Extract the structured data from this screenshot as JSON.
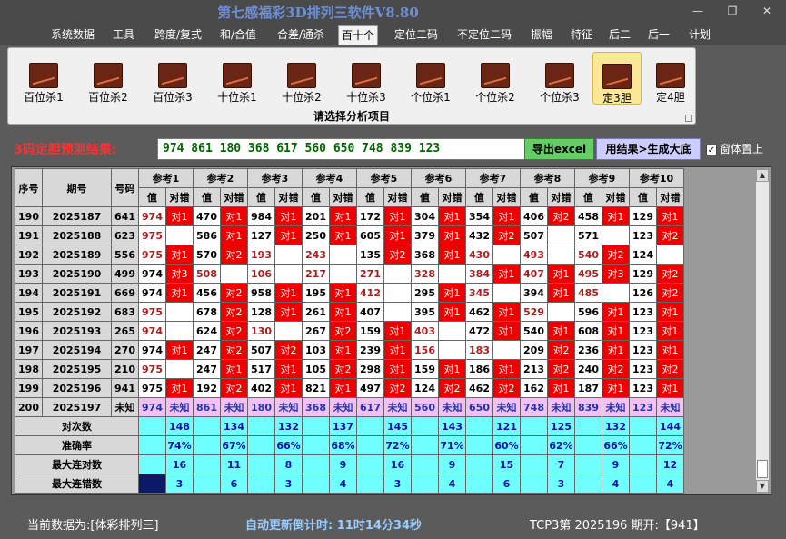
{
  "window": {
    "title": "第七感福彩3D排列三软件V8.80",
    "minimize": "—",
    "restore": "❐",
    "close": "✕"
  },
  "menu": [
    "系统数据",
    "工具",
    "跨度/复式",
    "和/合值",
    "合差/通杀",
    "百十个",
    "定位二码",
    "不定位二码",
    "振幅",
    "特征",
    "后二",
    "后一",
    "计划"
  ],
  "menu_active": 5,
  "ribbon": {
    "buttons": [
      "百位杀1",
      "百位杀2",
      "百位杀3",
      "十位杀1",
      "十位杀2",
      "十位杀3",
      "个位杀1",
      "个位杀2",
      "个位杀3",
      "定3胆",
      "定4胆"
    ],
    "selected": 9,
    "caption": "请选择分析项目"
  },
  "predict": {
    "label": "3码定胆预测结果:",
    "value": "974 861 180 368 617 560 650 748 839 123",
    "export_label": "导出excel",
    "generate_label": "用结果>生成大底",
    "topmost_label": "窗体置上",
    "topmost_checked": "✓"
  },
  "table": {
    "headers": {
      "seq": "序号",
      "issue": "期号",
      "code": "号码",
      "value": "值",
      "result": "对错"
    },
    "refs": [
      "参考1",
      "参考2",
      "参考3",
      "参考4",
      "参考5",
      "参考6",
      "参考7",
      "参考8",
      "参考9",
      "参考10"
    ],
    "rows": [
      {
        "seq": "190",
        "issue": "2025187",
        "code": "641",
        "cells": [
          [
            "974",
            "对1"
          ],
          [
            "470",
            "对1"
          ],
          [
            "984",
            "对1"
          ],
          [
            "201",
            "对1"
          ],
          [
            "172",
            "对1"
          ],
          [
            "304",
            "对1"
          ],
          [
            "354",
            "对1"
          ],
          [
            "406",
            "对2"
          ],
          [
            "458",
            "对1"
          ],
          [
            "129",
            "对1"
          ]
        ]
      },
      {
        "seq": "191",
        "issue": "2025188",
        "code": "623",
        "cells": [
          [
            "975",
            ""
          ],
          [
            "586",
            "对1"
          ],
          [
            "127",
            "对1"
          ],
          [
            "250",
            "对1"
          ],
          [
            "605",
            "对1"
          ],
          [
            "379",
            "对1"
          ],
          [
            "432",
            "对2"
          ],
          [
            "507",
            ""
          ],
          [
            "571",
            ""
          ],
          [
            "123",
            "对2"
          ]
        ]
      },
      {
        "seq": "192",
        "issue": "2025189",
        "code": "556",
        "cells": [
          [
            "975",
            "对1"
          ],
          [
            "570",
            "对2"
          ],
          [
            "193",
            ""
          ],
          [
            "243",
            ""
          ],
          [
            "135",
            "对2"
          ],
          [
            "368",
            "对1"
          ],
          [
            "430",
            ""
          ],
          [
            "493",
            ""
          ],
          [
            "540",
            "对2"
          ],
          [
            "124",
            ""
          ]
        ]
      },
      {
        "seq": "193",
        "issue": "2025190",
        "code": "499",
        "cells": [
          [
            "974",
            "对3"
          ],
          [
            "508",
            ""
          ],
          [
            "106",
            ""
          ],
          [
            "217",
            ""
          ],
          [
            "271",
            ""
          ],
          [
            "328",
            ""
          ],
          [
            "384",
            "对1"
          ],
          [
            "407",
            "对1"
          ],
          [
            "495",
            "对3"
          ],
          [
            "129",
            "对2"
          ]
        ]
      },
      {
        "seq": "194",
        "issue": "2025191",
        "code": "669",
        "cells": [
          [
            "974",
            "对1"
          ],
          [
            "456",
            "对2"
          ],
          [
            "958",
            "对1"
          ],
          [
            "195",
            "对1"
          ],
          [
            "412",
            ""
          ],
          [
            "295",
            "对1"
          ],
          [
            "345",
            ""
          ],
          [
            "394",
            "对1"
          ],
          [
            "485",
            ""
          ],
          [
            "126",
            "对2"
          ]
        ]
      },
      {
        "seq": "195",
        "issue": "2025192",
        "code": "683",
        "cells": [
          [
            "975",
            ""
          ],
          [
            "678",
            "对2"
          ],
          [
            "128",
            "对1"
          ],
          [
            "261",
            "对1"
          ],
          [
            "407",
            ""
          ],
          [
            "395",
            "对1"
          ],
          [
            "462",
            "对1"
          ],
          [
            "529",
            ""
          ],
          [
            "596",
            "对1"
          ],
          [
            "123",
            "对1"
          ]
        ]
      },
      {
        "seq": "196",
        "issue": "2025193",
        "code": "265",
        "cells": [
          [
            "974",
            ""
          ],
          [
            "624",
            "对2"
          ],
          [
            "130",
            ""
          ],
          [
            "267",
            "对2"
          ],
          [
            "159",
            "对1"
          ],
          [
            "403",
            ""
          ],
          [
            "472",
            "对1"
          ],
          [
            "540",
            "对1"
          ],
          [
            "608",
            "对1"
          ],
          [
            "123",
            "对1"
          ]
        ]
      },
      {
        "seq": "197",
        "issue": "2025194",
        "code": "270",
        "cells": [
          [
            "974",
            "对1"
          ],
          [
            "247",
            "对2"
          ],
          [
            "507",
            "对2"
          ],
          [
            "103",
            "对1"
          ],
          [
            "239",
            "对1"
          ],
          [
            "156",
            ""
          ],
          [
            "183",
            ""
          ],
          [
            "209",
            "对2"
          ],
          [
            "236",
            "对1"
          ],
          [
            "123",
            "对1"
          ]
        ]
      },
      {
        "seq": "198",
        "issue": "2025195",
        "code": "210",
        "cells": [
          [
            "975",
            ""
          ],
          [
            "247",
            "对1"
          ],
          [
            "517",
            "对1"
          ],
          [
            "105",
            "对2"
          ],
          [
            "298",
            "对1"
          ],
          [
            "159",
            "对1"
          ],
          [
            "186",
            "对1"
          ],
          [
            "213",
            "对2"
          ],
          [
            "240",
            "对2"
          ],
          [
            "123",
            "对2"
          ]
        ]
      },
      {
        "seq": "199",
        "issue": "2025196",
        "code": "941",
        "cells": [
          [
            "975",
            "对1"
          ],
          [
            "192",
            "对2"
          ],
          [
            "402",
            "对1"
          ],
          [
            "821",
            "对1"
          ],
          [
            "497",
            "对2"
          ],
          [
            "124",
            "对2"
          ],
          [
            "462",
            "对2"
          ],
          [
            "162",
            "对1"
          ],
          [
            "187",
            "对1"
          ],
          [
            "123",
            "对1"
          ]
        ]
      }
    ],
    "red_values": [
      [
        0,
        "0"
      ],
      [
        1,
        "0"
      ],
      [
        2,
        "0,2,3,6,7,8"
      ],
      [
        3,
        "1,2,3,4,5,6,7,8"
      ],
      [
        4,
        "4,6,8"
      ],
      [
        5,
        "0,7"
      ],
      [
        6,
        "0,2,5"
      ],
      [
        7,
        "5,6"
      ],
      [
        8,
        "0"
      ],
      [
        9,
        ""
      ]
    ],
    "predict_row": {
      "seq": "200",
      "issue": "2025197",
      "code": "未知",
      "cells": [
        [
          "974",
          "未知"
        ],
        [
          "861",
          "未知"
        ],
        [
          "180",
          "未知"
        ],
        [
          "368",
          "未知"
        ],
        [
          "617",
          "未知"
        ],
        [
          "560",
          "未知"
        ],
        [
          "650",
          "未知"
        ],
        [
          "748",
          "未知"
        ],
        [
          "839",
          "未知"
        ],
        [
          "123",
          "未知"
        ]
      ]
    },
    "stats": [
      {
        "label": "对次数",
        "values": [
          "148",
          "134",
          "132",
          "137",
          "145",
          "143",
          "121",
          "125",
          "132",
          "144"
        ]
      },
      {
        "label": "准确率",
        "values": [
          "74%",
          "67%",
          "66%",
          "68%",
          "72%",
          "71%",
          "60%",
          "62%",
          "66%",
          "72%"
        ]
      },
      {
        "label": "最大连对数",
        "values": [
          "16",
          "11",
          "8",
          "9",
          "16",
          "9",
          "15",
          "7",
          "9",
          "12"
        ]
      },
      {
        "label": "最大连错数",
        "values": [
          "3",
          "6",
          "3",
          "4",
          "3",
          "4",
          "6",
          "3",
          "4",
          "4"
        ]
      }
    ]
  },
  "status": {
    "source": "当前数据为:[体彩排列三]",
    "timer": "自动更新倒计时: 11时14分34秒",
    "draw": "TCP3第 2025196 期开:【941】"
  },
  "colors": {
    "hit": "#ee0000",
    "stat": "#70ffff",
    "predict_row": "#f4c0f4",
    "accent_red": "#ff3030"
  }
}
